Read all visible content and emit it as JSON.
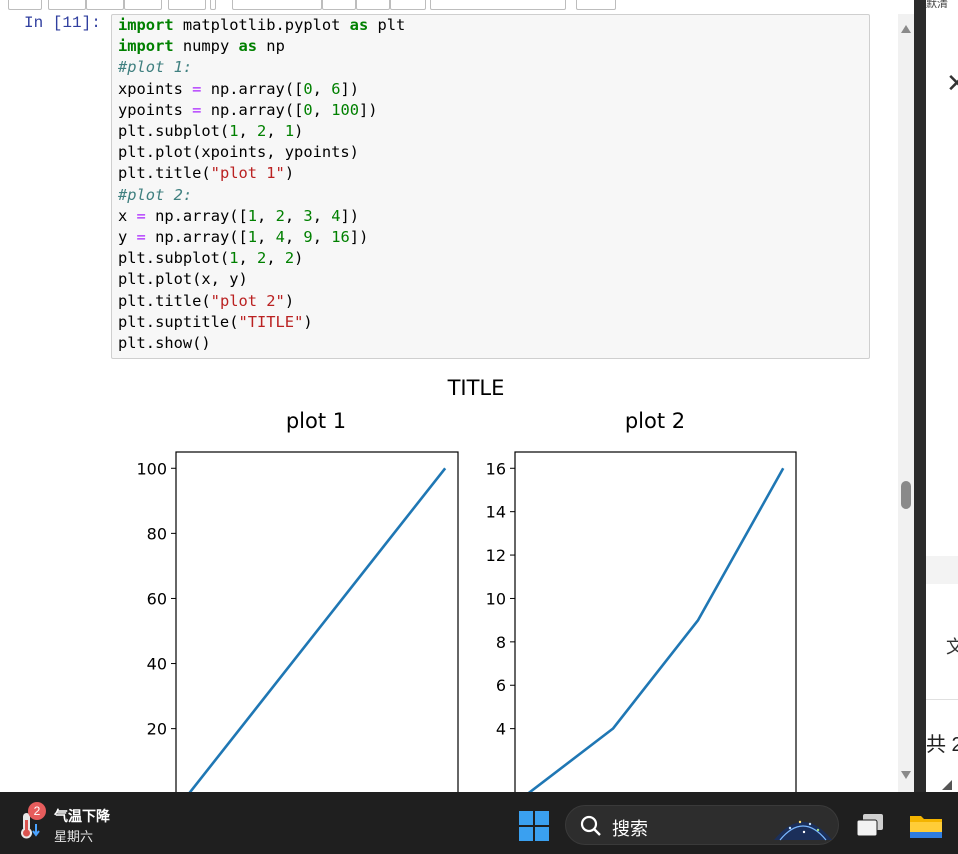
{
  "notebook": {
    "prompt": "In  [11]:",
    "code_lines": [
      [
        {
          "t": "import",
          "c": "kw"
        },
        {
          "t": " matplotlib.pyplot ",
          "c": ""
        },
        {
          "t": "as",
          "c": "kw"
        },
        {
          "t": " plt",
          "c": ""
        }
      ],
      [
        {
          "t": "import",
          "c": "kw"
        },
        {
          "t": " numpy ",
          "c": ""
        },
        {
          "t": "as",
          "c": "kw"
        },
        {
          "t": " np",
          "c": ""
        }
      ],
      [
        {
          "t": "#plot 1:",
          "c": "cm"
        }
      ],
      [
        {
          "t": "xpoints ",
          "c": ""
        },
        {
          "t": "=",
          "c": "op"
        },
        {
          "t": " np.array([",
          "c": ""
        },
        {
          "t": "0",
          "c": "num"
        },
        {
          "t": ", ",
          "c": ""
        },
        {
          "t": "6",
          "c": "num"
        },
        {
          "t": "])",
          "c": ""
        }
      ],
      [
        {
          "t": "ypoints ",
          "c": ""
        },
        {
          "t": "=",
          "c": "op"
        },
        {
          "t": " np.array([",
          "c": ""
        },
        {
          "t": "0",
          "c": "num"
        },
        {
          "t": ", ",
          "c": ""
        },
        {
          "t": "100",
          "c": "num"
        },
        {
          "t": "])",
          "c": ""
        }
      ],
      [
        {
          "t": "plt.subplot(",
          "c": ""
        },
        {
          "t": "1",
          "c": "num"
        },
        {
          "t": ", ",
          "c": ""
        },
        {
          "t": "2",
          "c": "num"
        },
        {
          "t": ", ",
          "c": ""
        },
        {
          "t": "1",
          "c": "num"
        },
        {
          "t": ")",
          "c": ""
        }
      ],
      [
        {
          "t": "plt.plot(xpoints, ypoints)",
          "c": ""
        }
      ],
      [
        {
          "t": "plt.title(",
          "c": ""
        },
        {
          "t": "\"plot 1\"",
          "c": "str"
        },
        {
          "t": ")",
          "c": ""
        }
      ],
      [
        {
          "t": "#plot 2:",
          "c": "cm"
        }
      ],
      [
        {
          "t": "x ",
          "c": ""
        },
        {
          "t": "=",
          "c": "op"
        },
        {
          "t": " np.array([",
          "c": ""
        },
        {
          "t": "1",
          "c": "num"
        },
        {
          "t": ", ",
          "c": ""
        },
        {
          "t": "2",
          "c": "num"
        },
        {
          "t": ", ",
          "c": ""
        },
        {
          "t": "3",
          "c": "num"
        },
        {
          "t": ", ",
          "c": ""
        },
        {
          "t": "4",
          "c": "num"
        },
        {
          "t": "])",
          "c": ""
        }
      ],
      [
        {
          "t": "y ",
          "c": ""
        },
        {
          "t": "=",
          "c": "op"
        },
        {
          "t": " np.array([",
          "c": ""
        },
        {
          "t": "1",
          "c": "num"
        },
        {
          "t": ", ",
          "c": ""
        },
        {
          "t": "4",
          "c": "num"
        },
        {
          "t": ", ",
          "c": ""
        },
        {
          "t": "9",
          "c": "num"
        },
        {
          "t": ", ",
          "c": ""
        },
        {
          "t": "16",
          "c": "num"
        },
        {
          "t": "])",
          "c": ""
        }
      ],
      [
        {
          "t": "plt.subplot(",
          "c": ""
        },
        {
          "t": "1",
          "c": "num"
        },
        {
          "t": ", ",
          "c": ""
        },
        {
          "t": "2",
          "c": "num"
        },
        {
          "t": ", ",
          "c": ""
        },
        {
          "t": "2",
          "c": "num"
        },
        {
          "t": ")",
          "c": ""
        }
      ],
      [
        {
          "t": "plt.plot(x, y)",
          "c": ""
        }
      ],
      [
        {
          "t": "plt.title(",
          "c": ""
        },
        {
          "t": "\"plot 2\"",
          "c": "str"
        },
        {
          "t": ")",
          "c": ""
        }
      ],
      [
        {
          "t": "plt.suptitle(",
          "c": ""
        },
        {
          "t": "\"TITLE\"",
          "c": "str"
        },
        {
          "t": ")",
          "c": ""
        }
      ],
      [
        {
          "t": "plt.show()",
          "c": ""
        }
      ]
    ]
  },
  "chart_data": {
    "suptitle": "TITLE",
    "line_color": "#1f77b4",
    "subplots": [
      {
        "type": "line",
        "title": "plot 1",
        "x": [
          0,
          6
        ],
        "y": [
          0,
          100
        ],
        "xlim": [
          -0.3,
          6.3
        ],
        "ylim": [
          -5,
          105
        ],
        "yticks": [
          20,
          40,
          60,
          80,
          100
        ],
        "ytick_labels": [
          "20",
          "40",
          "60",
          "80",
          "100"
        ]
      },
      {
        "type": "line",
        "title": "plot 2",
        "x": [
          1,
          2,
          3,
          4
        ],
        "y": [
          1,
          4,
          9,
          16
        ],
        "xlim": [
          0.85,
          4.15
        ],
        "ylim": [
          0.25,
          16.75
        ],
        "yticks": [
          4,
          6,
          8,
          10,
          12,
          14,
          16
        ],
        "ytick_labels": [
          "4",
          "6",
          "8",
          "10",
          "12",
          "14",
          "16"
        ]
      }
    ]
  },
  "right_panel": {
    "top_text": "默清",
    "char_wen": "文",
    "text_gong": "共 2"
  },
  "taskbar": {
    "weather_badge": "2",
    "weather_title": "气温下降",
    "weather_sub": "星期六",
    "search_placeholder": "搜索"
  }
}
